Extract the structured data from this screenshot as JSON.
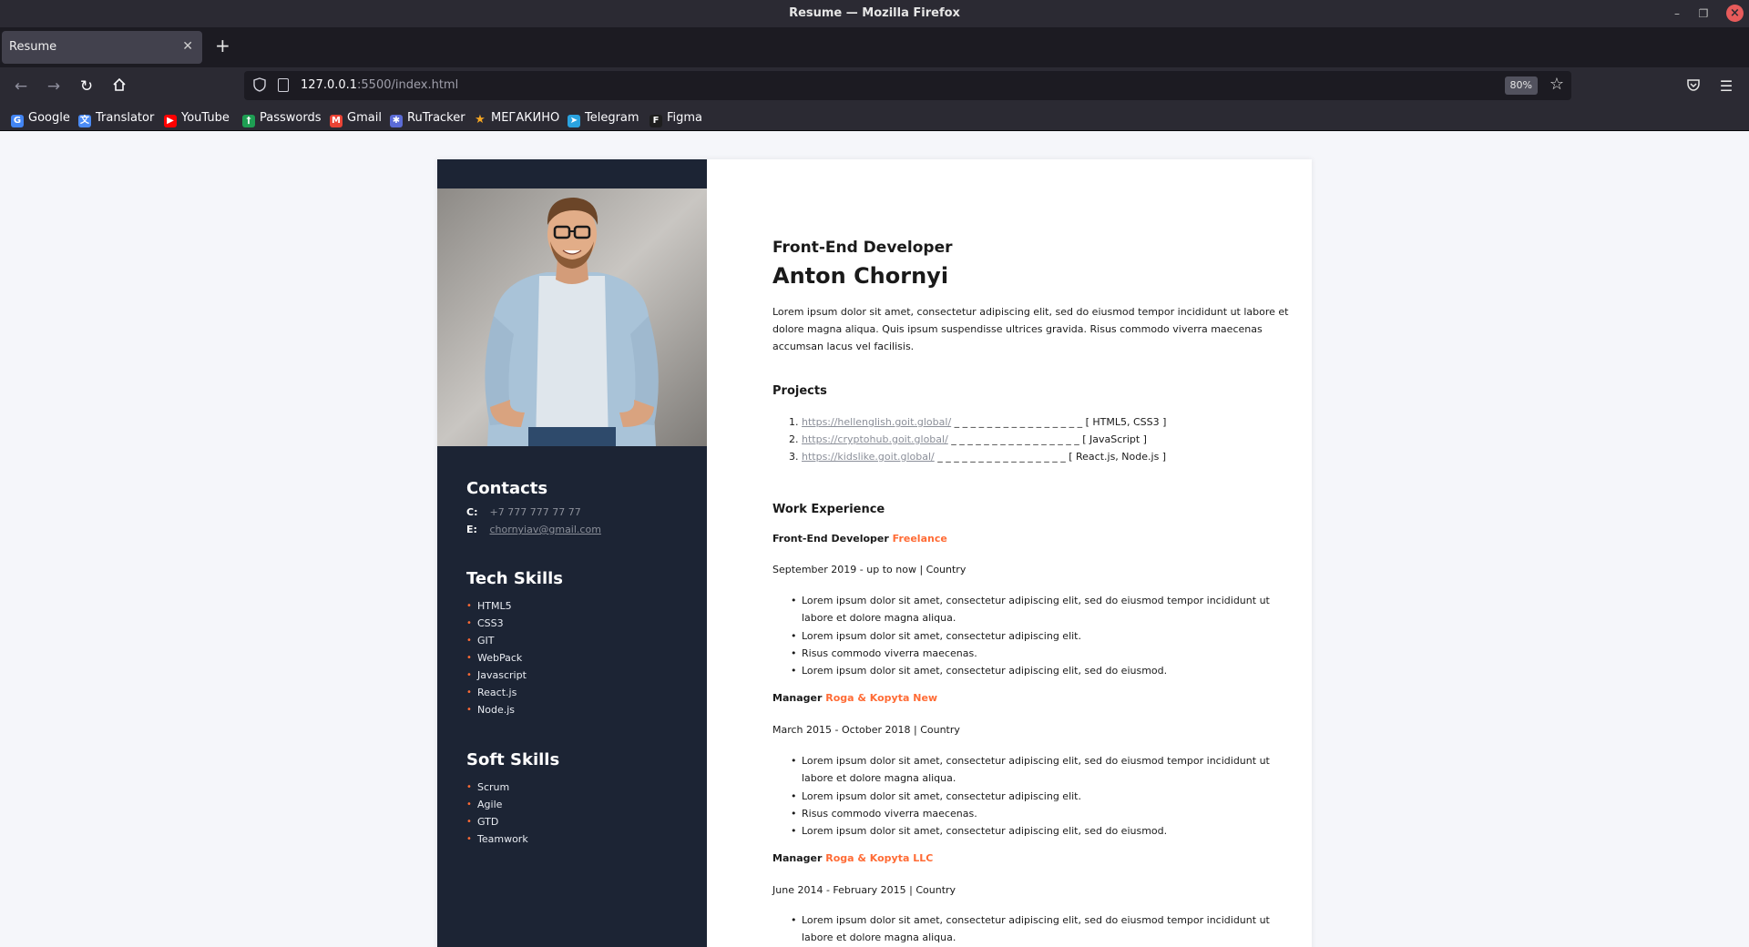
{
  "window": {
    "title": "Resume — Mozilla Firefox"
  },
  "tab": {
    "label": "Resume"
  },
  "urlbar": {
    "url_host": "127.0.0.1",
    "url_path": ":5500/index.html",
    "zoom": "80%"
  },
  "bookmarks": [
    {
      "label": "Google",
      "icon": "google-icon",
      "color": "#4285f4"
    },
    {
      "label": "Translator",
      "icon": "translate-icon",
      "color": "#4b8bf5"
    },
    {
      "label": "YouTube",
      "icon": "youtube-icon",
      "color": "#ff0000"
    },
    {
      "label": "Passwords",
      "icon": "passwords-icon",
      "color": "#1e9e53"
    },
    {
      "label": "Gmail",
      "icon": "gmail-icon",
      "color": "#ea4335"
    },
    {
      "label": "RuTracker",
      "icon": "rutracker-icon",
      "color": "#5b6bd6"
    },
    {
      "label": "МЕГАКИНО",
      "icon": "star-icon",
      "color": "#f5a623"
    },
    {
      "label": "Telegram",
      "icon": "telegram-icon",
      "color": "#2aa3e0"
    },
    {
      "label": "Figma",
      "icon": "figma-icon",
      "color": "#1e1e1e"
    }
  ],
  "sidebar": {
    "contacts_title": "Contacts",
    "phone_key": "C:",
    "phone": "+7 777 777 77 77",
    "email_key": "E:",
    "email": "chornyiav@gmail.com",
    "tech_title": "Tech Skills",
    "tech": [
      "HTML5",
      "CSS3",
      "GIT",
      "WebPack",
      "Javascript",
      "React.js",
      "Node.js"
    ],
    "soft_title": "Soft Skills",
    "soft": [
      "Scrum",
      "Agile",
      "GTD",
      "Teamwork"
    ]
  },
  "main": {
    "job_title": "Front-End Developer",
    "name": "Anton Chornyi",
    "intro": "Lorem ipsum dolor sit amet, consectetur adipiscing elit, sed do eiusmod tempor incididunt ut labore et dolore magna aliqua. Quis ipsum suspendisse ultrices gravida. Risus commodo viverra maecenas accumsan lacus vel facilisis.",
    "projects_title": "Projects",
    "projects": [
      {
        "num": "1.",
        "url": "https://hellenglish.goit.global/",
        "dashes": " _ _ _ _ _ _ _ _ _ _ _ _ _ _ _ _ ",
        "tech": "[ HTML5, CSS3 ]"
      },
      {
        "num": "2.",
        "url": "https://cryptohub.goit.global/",
        "dashes": " _ _ _ _ _ _ _ _ _ _ _ _ _ _ _ _ ",
        "tech": "[ JavaScript ]"
      },
      {
        "num": "3.",
        "url": "https://kidslike.goit.global/",
        "dashes": " _ _ _ _ _ _ _ _ _ _ _ _ _ _ _ _ ",
        "tech": "[ React.js, Node.js ]"
      }
    ],
    "work_title": "Work Experience",
    "jobs": [
      {
        "role": "Front-End Developer",
        "company": "Freelance",
        "date": "September 2019 - up to now | Country",
        "duties": [
          "Lorem ipsum dolor sit amet, consectetur adipiscing elit, sed do eiusmod tempor incididunt ut labore et dolore magna aliqua.",
          "Lorem ipsum dolor sit amet, consectetur adipiscing elit.",
          "Risus commodo viverra maecenas.",
          "Lorem ipsum dolor sit amet, consectetur adipiscing elit, sed do eiusmod."
        ]
      },
      {
        "role": "Manager",
        "company": "Roga & Kopyta New",
        "date": "March 2015 - October 2018 | Country",
        "duties": [
          "Lorem ipsum dolor sit amet, consectetur adipiscing elit, sed do eiusmod tempor incididunt ut labore et dolore magna aliqua.",
          "Lorem ipsum dolor sit amet, consectetur adipiscing elit.",
          "Risus commodo viverra maecenas.",
          "Lorem ipsum dolor sit amet, consectetur adipiscing elit, sed do eiusmod."
        ]
      },
      {
        "role": "Manager",
        "company": "Roga & Kopyta LLC",
        "date": "June 2014 - February 2015 | Country",
        "duties": [
          "Lorem ipsum dolor sit amet, consectetur adipiscing elit, sed do eiusmod tempor incididunt ut labore et dolore magna aliqua."
        ]
      }
    ]
  },
  "colors": {
    "accent": "#ff6b35",
    "sidebar_bg": "#1c2434"
  }
}
